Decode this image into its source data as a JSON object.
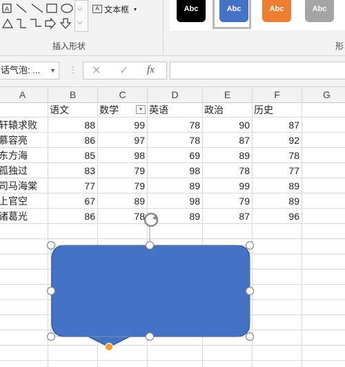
{
  "ribbon": {
    "textbox_label": "文本框",
    "group_insert_shapes": "插入形状",
    "group_shape_styles": "形",
    "style_chips": [
      {
        "label": "Abc",
        "color": "#000000"
      },
      {
        "label": "Abc",
        "color": "#4472c4"
      },
      {
        "label": "Abc",
        "color": "#ed7d31"
      },
      {
        "label": "Abc",
        "color": "#a5a5a5"
      }
    ]
  },
  "formula_bar": {
    "name_box": "话气泡: ...",
    "cancel": "✕",
    "enter": "✓",
    "fx": "fx",
    "value": ""
  },
  "columns": [
    "A",
    "B",
    "C",
    "D",
    "E",
    "F",
    "G"
  ],
  "headers": [
    "",
    "语文",
    "数学",
    "英语",
    "政治",
    "历史"
  ],
  "rows": [
    {
      "name": "轩辕求败",
      "scores": [
        "88",
        "99",
        "78",
        "90",
        "87"
      ]
    },
    {
      "name": "慕容亮",
      "scores": [
        "86",
        "97",
        "78",
        "87",
        "92"
      ]
    },
    {
      "name": "东方海",
      "scores": [
        "85",
        "98",
        "69",
        "89",
        "78"
      ]
    },
    {
      "name": "孤独过",
      "scores": [
        "83",
        "79",
        "98",
        "78",
        "77"
      ]
    },
    {
      "name": "司马海棠",
      "scores": [
        "77",
        "79",
        "89",
        "99",
        "89"
      ]
    },
    {
      "name": "上官空",
      "scores": [
        "67",
        "89",
        "98",
        "79",
        "89"
      ]
    },
    {
      "name": "诸葛光",
      "scores": [
        "86",
        "78",
        "89",
        "87",
        "96"
      ]
    }
  ],
  "colors": {
    "callout_fill": "#4472c4",
    "callout_border": "#2f528f",
    "tail_handle": "#f0a030"
  }
}
